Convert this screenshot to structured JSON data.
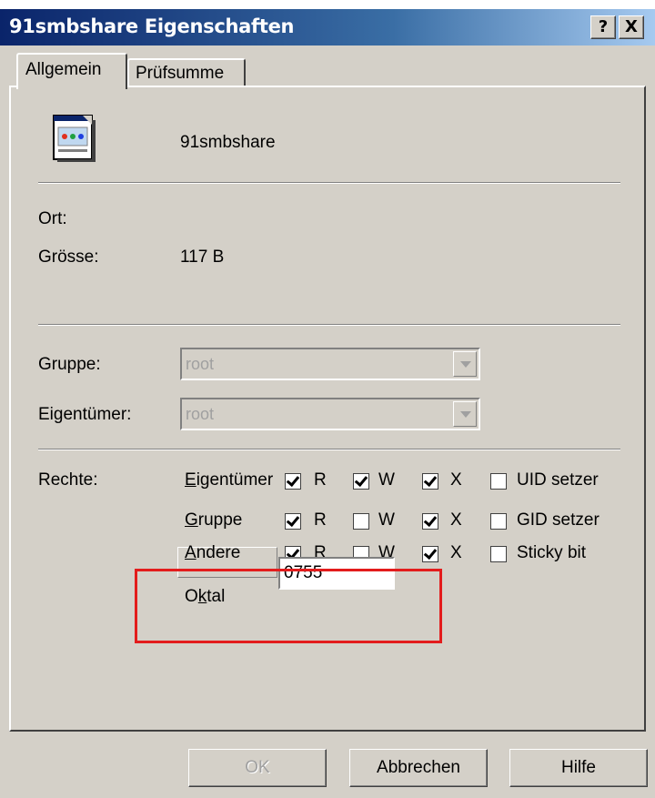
{
  "window": {
    "title": "91smbshare Eigenschaften",
    "help_btn": "?",
    "close_btn": "X"
  },
  "tabs": [
    {
      "label": "Allgemein",
      "active": true
    },
    {
      "label": "Prüfsumme",
      "active": false
    }
  ],
  "file": {
    "name": "91smbshare",
    "icon": "document-icon"
  },
  "info": {
    "ort_label": "Ort:",
    "ort_value": "",
    "groesse_label": "Grösse:",
    "groesse_value": "117 B"
  },
  "owner": {
    "gruppe_label": "Gruppe:",
    "gruppe_value": "root",
    "eigentuemer_label": "Eigentümer:",
    "eigentuemer_value": "root"
  },
  "rights": {
    "label": "Rechte:",
    "rows": [
      {
        "name_first": "E",
        "name_rest": "igentümer",
        "r": true,
        "w": true,
        "x": true,
        "special_label": "UID setzer",
        "special": false
      },
      {
        "name_first": "G",
        "name_rest": "ruppe",
        "r": true,
        "w": false,
        "x": true,
        "special_label": "GID setzer",
        "special": false
      },
      {
        "name_first": "A",
        "name_rest": "ndere",
        "r": true,
        "w": false,
        "x": true,
        "special_label": "Sticky bit",
        "special": false
      }
    ],
    "r_label": "R",
    "w_label": "W",
    "x_label": "X",
    "octal_label_pre": "O",
    "octal_label_key": "k",
    "octal_label_post": "tal",
    "octal_value": "0755"
  },
  "buttons": {
    "ok": "OK",
    "cancel": "Abbrechen",
    "help": "Hilfe"
  },
  "colors": {
    "highlight": "#e31c1c"
  }
}
